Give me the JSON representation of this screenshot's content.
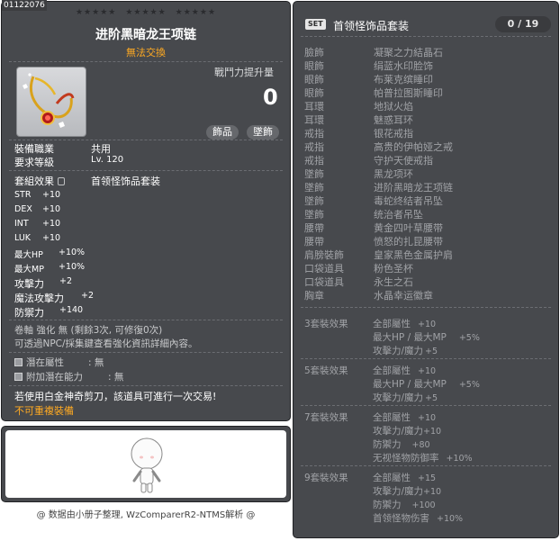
{
  "id_tag": "01122076",
  "item": {
    "name": "进阶黑暗龙王项链",
    "trade": "無法交換",
    "power_label": "戰鬥力提升量",
    "power_value": "0",
    "tags": [
      "飾品",
      "墜飾"
    ],
    "job_label": "裝備職業",
    "job_value": "共用",
    "level_label": "要求等級",
    "level_value": "Lv. 120",
    "set_label": "套組效果",
    "set_value": "首领怪饰品套装",
    "stats": [
      {
        "k": "STR",
        "v": "+10"
      },
      {
        "k": "DEX",
        "v": "+10"
      },
      {
        "k": "INT",
        "v": "+10"
      },
      {
        "k": "LUK",
        "v": "+10"
      },
      {
        "k": "最大HP",
        "v": "+10%"
      },
      {
        "k": "最大MP",
        "v": "+10%"
      },
      {
        "k": "攻擊力",
        "v": "+2"
      },
      {
        "k": "魔法攻擊力",
        "v": "+2"
      },
      {
        "k": "防禦力",
        "v": "+140"
      }
    ],
    "scroll_line": "卷軸 強化 無 (剩餘3次, 可修復0次)",
    "npc_line": "可透過NPC/採集鍵查看強化資訊詳細內容。",
    "potential_label": "潛在屬性",
    "potential_value": ": 無",
    "bonus_potential_label": "附加潛在能力",
    "bonus_potential_value": ": 無",
    "scissors_note": "若使用白金神奇剪刀，該道具可進行一次交易!",
    "unique_note": "不可重複裝備"
  },
  "footer": "@ 数据由小册子整理, WzComparerR2-NTMS解析 @",
  "set": {
    "badge": "SET",
    "title": "首领怪饰品套装",
    "count": "0 / 19",
    "items": [
      {
        "k": "臉飾",
        "v": "凝聚之力結晶石"
      },
      {
        "k": "眼飾",
        "v": "绢蓝水印脸饰"
      },
      {
        "k": "眼飾",
        "v": "布莱克缤睡印"
      },
      {
        "k": "眼飾",
        "v": "帕普拉图斯睡印"
      },
      {
        "k": "耳環",
        "v": "地狱火焰"
      },
      {
        "k": "耳環",
        "v": "魅惑耳环"
      },
      {
        "k": "戒指",
        "v": "银花戒指"
      },
      {
        "k": "戒指",
        "v": "高贵的伊帕娅之戒"
      },
      {
        "k": "戒指",
        "v": "守护天使戒指"
      },
      {
        "k": "墜飾",
        "v": "黑龙项环"
      },
      {
        "k": "墜飾",
        "v": "进阶黑暗龙王项链"
      },
      {
        "k": "墜飾",
        "v": "毒蛇终结者吊坠"
      },
      {
        "k": "墜飾",
        "v": "统治者吊坠"
      },
      {
        "k": "腰帶",
        "v": "黄金四叶草腰带"
      },
      {
        "k": "腰帶",
        "v": "愤怒的扎昆腰带"
      },
      {
        "k": "肩膀裝飾",
        "v": "皇家黑色金属护肩"
      },
      {
        "k": "口袋道具",
        "v": "粉色圣杯"
      },
      {
        "k": "口袋道具",
        "v": "永生之石"
      },
      {
        "k": "胸章",
        "v": "水晶幸运徽章"
      }
    ],
    "bonuses": [
      {
        "hdr": "3套裝效果",
        "lines": [
          {
            "t": "全部屬性",
            "v": "+10"
          },
          {
            "t": "最大HP / 最大MP",
            "v": "+5%"
          },
          {
            "t": "攻擊力/魔力",
            "v": "+5"
          }
        ]
      },
      {
        "hdr": "5套裝效果",
        "lines": [
          {
            "t": "全部屬性",
            "v": "+10"
          },
          {
            "t": "最大HP / 最大MP",
            "v": "+5%"
          },
          {
            "t": "攻擊力/魔力",
            "v": "+5"
          }
        ]
      },
      {
        "hdr": "7套裝效果",
        "lines": [
          {
            "t": "全部屬性",
            "v": "+10"
          },
          {
            "t": "攻擊力/魔力",
            "v": "+10"
          },
          {
            "t": "防禦力",
            "v": "+80"
          },
          {
            "t": "无视怪物防御率",
            "v": "+10%"
          }
        ]
      },
      {
        "hdr": "9套裝效果",
        "lines": [
          {
            "t": "全部屬性",
            "v": "+15"
          },
          {
            "t": "攻擊力/魔力",
            "v": "+10"
          },
          {
            "t": "防禦力",
            "v": "+100"
          },
          {
            "t": "首领怪物伤害",
            "v": "+10%"
          }
        ]
      }
    ]
  }
}
